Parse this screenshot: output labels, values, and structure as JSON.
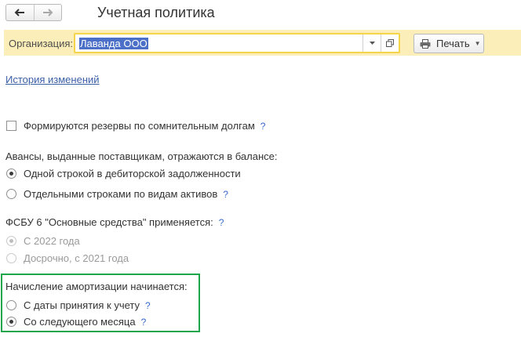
{
  "header": {
    "back_icon": "arrow-left-icon",
    "forward_icon": "arrow-right-icon",
    "title": "Учетная политика"
  },
  "org": {
    "label": "Организация:",
    "value": "Лаванда ООО",
    "print_label": "Печать",
    "accent": "#f5d44a",
    "bar_color": "#fbeeb8"
  },
  "history_link": "История изменений",
  "reserves": {
    "label": "Формируются резервы по сомнительным долгам",
    "checked": false,
    "help": "?"
  },
  "advances": {
    "heading": "Авансы, выданные поставщикам, отражаются в балансе:",
    "options": [
      {
        "label": "Одной строкой в дебиторской задолженности",
        "selected": true
      },
      {
        "label": "Отдельными строками по видам активов",
        "selected": false,
        "help": "?"
      }
    ]
  },
  "fsbu": {
    "heading": "ФСБУ 6 \"Основные средства\" применяется:",
    "help": "?",
    "options": [
      {
        "label": "С 2022 года",
        "selected": true,
        "disabled": true
      },
      {
        "label": "Досрочно, с 2021 года",
        "selected": false,
        "disabled": true
      }
    ]
  },
  "depreciation": {
    "heading": "Начисление амортизации начинается:",
    "highlight_color": "#1fa64a",
    "options": [
      {
        "label": "С даты принятия к учету",
        "selected": false,
        "help": "?"
      },
      {
        "label": "Со следующего месяца",
        "selected": true,
        "help": "?"
      }
    ]
  }
}
